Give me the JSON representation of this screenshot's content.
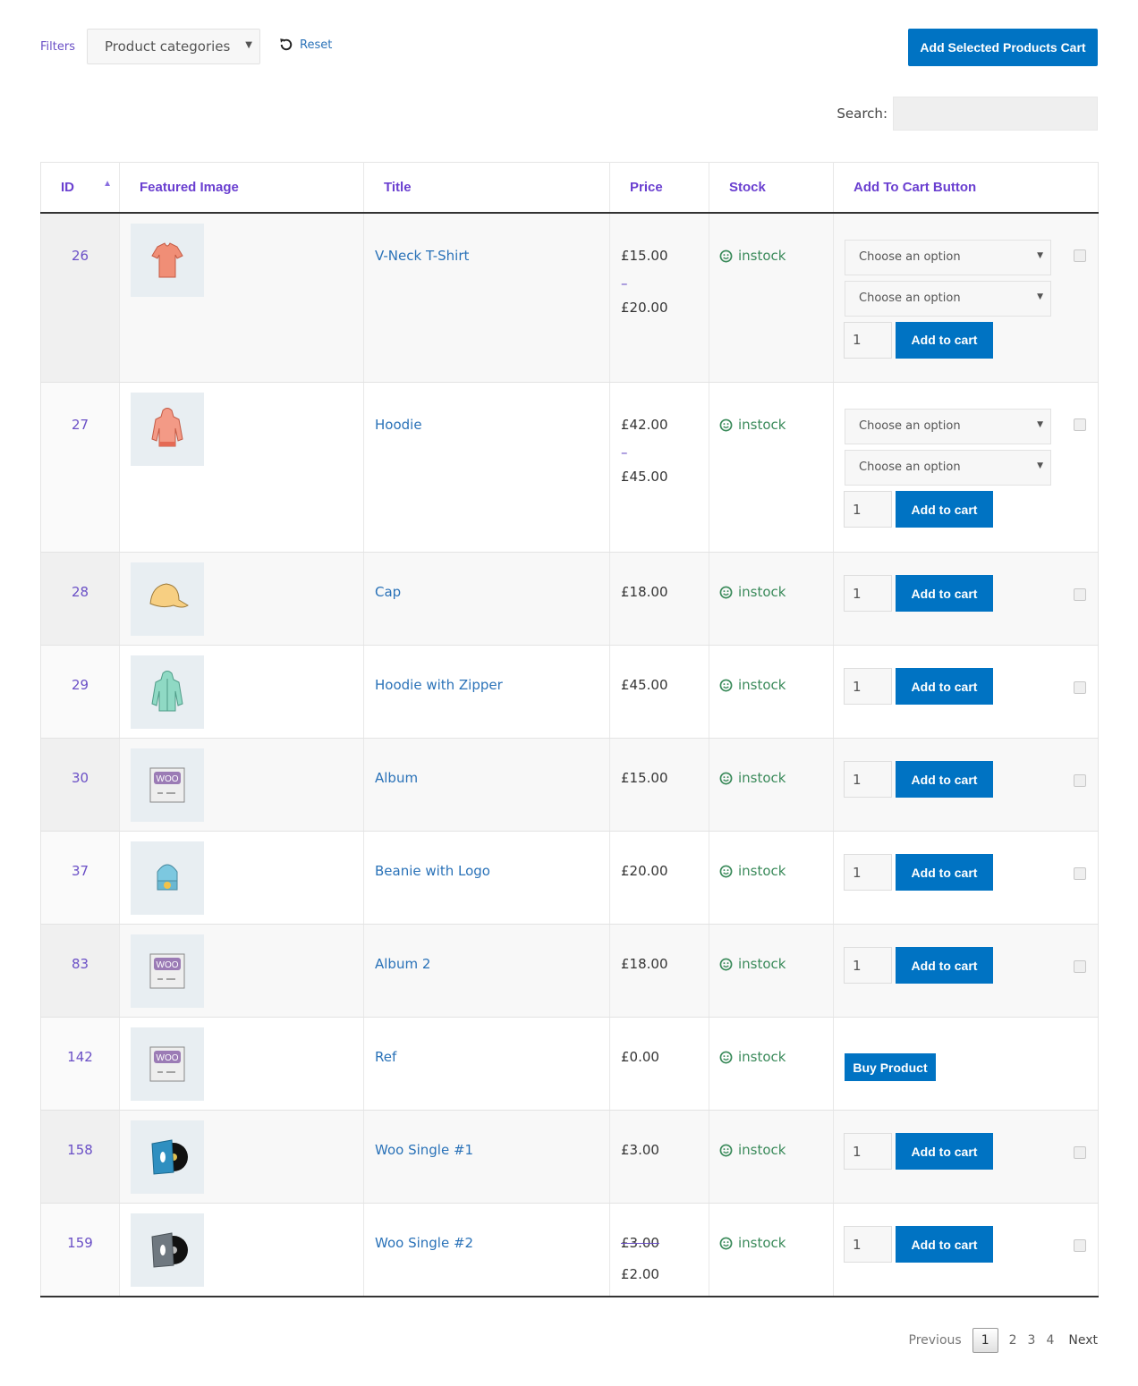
{
  "filters": {
    "label": "Filters",
    "category_select": "Product categories",
    "reset_label": "Reset"
  },
  "toolbar": {
    "add_selected_label": "Add Selected Products Cart",
    "search_label": "Search:",
    "search_value": "",
    "brand_color": "#0073c3"
  },
  "table": {
    "columns": [
      "ID",
      "Featured Image",
      "Title",
      "Price",
      "Stock",
      "Add To Cart Button"
    ],
    "sort": {
      "column": "ID",
      "direction": "ascending"
    },
    "rows": [
      {
        "id": "26",
        "image": "vneck-tshirt",
        "title": "V-Neck T-Shirt",
        "price_min": "£15.00",
        "price_sep": "–",
        "price_max": "£20.00",
        "stock": "instock",
        "variations": [
          "Choose an option",
          "Choose an option"
        ],
        "qty": "1",
        "button": "Add to cart",
        "checkbox": true
      },
      {
        "id": "27",
        "image": "hoodie",
        "title": "Hoodie",
        "price_min": "£42.00",
        "price_sep": "–",
        "price_max": "£45.00",
        "stock": "instock",
        "variations": [
          "Choose an option",
          "Choose an option"
        ],
        "qty": "1",
        "button": "Add to cart",
        "checkbox": true
      },
      {
        "id": "28",
        "image": "cap",
        "title": "Cap",
        "price": "£18.00",
        "stock": "instock",
        "qty": "1",
        "button": "Add to cart",
        "checkbox": true
      },
      {
        "id": "29",
        "image": "hoodie-zipper",
        "title": "Hoodie with Zipper",
        "price": "£45.00",
        "stock": "instock",
        "qty": "1",
        "button": "Add to cart",
        "checkbox": true
      },
      {
        "id": "30",
        "image": "woo-album",
        "title": "Album",
        "price": "£15.00",
        "stock": "instock",
        "qty": "1",
        "button": "Add to cart",
        "checkbox": true
      },
      {
        "id": "37",
        "image": "beanie",
        "title": "Beanie with Logo",
        "price": "£20.00",
        "stock": "instock",
        "qty": "1",
        "button": "Add to cart",
        "checkbox": true
      },
      {
        "id": "83",
        "image": "woo-album",
        "title": "Album 2",
        "price": "£18.00",
        "stock": "instock",
        "qty": "1",
        "button": "Add to cart",
        "checkbox": true
      },
      {
        "id": "142",
        "image": "woo-album",
        "title": "Ref",
        "price": "£0.00",
        "stock": "instock",
        "button": "Buy Product",
        "checkbox": false
      },
      {
        "id": "158",
        "image": "vinyl-blue",
        "title": "Woo Single #1",
        "price": "£3.00",
        "stock": "instock",
        "qty": "1",
        "button": "Add to cart",
        "checkbox": true
      },
      {
        "id": "159",
        "image": "vinyl-grey",
        "title": "Woo Single #2",
        "price_regular": "£3.00",
        "price": "£2.00",
        "stock": "instock",
        "qty": "1",
        "button": "Add to cart",
        "checkbox": true
      }
    ]
  },
  "pagination": {
    "previous": "Previous",
    "pages": [
      "1",
      "2",
      "3",
      "4"
    ],
    "current": "1",
    "next": "Next"
  }
}
